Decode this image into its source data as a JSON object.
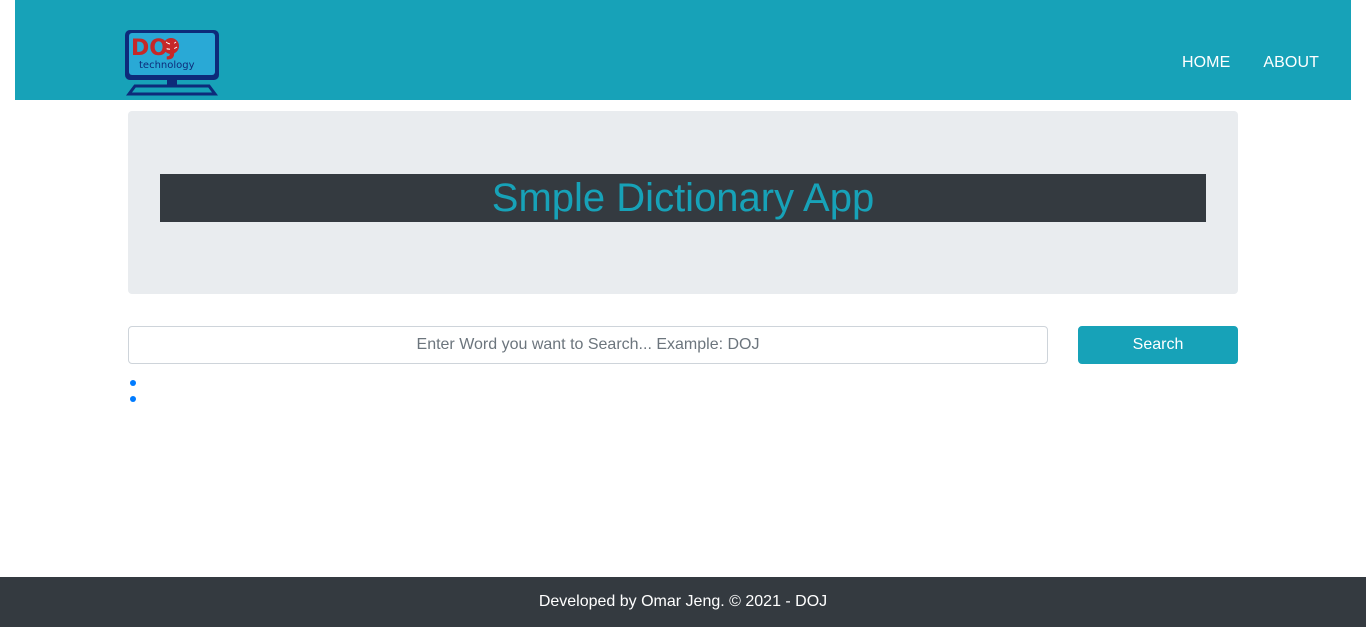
{
  "brand": {
    "logo_text": "DOJ",
    "logo_subtext": "technology"
  },
  "nav": {
    "items": [
      {
        "label": "HOME"
      },
      {
        "label": "ABOUT"
      }
    ]
  },
  "hero": {
    "title": "Smple Dictionary App"
  },
  "search": {
    "placeholder": "Enter Word you want to Search... Example: DOJ",
    "value": "",
    "button_label": "Search"
  },
  "results": {
    "items": [
      "",
      ""
    ]
  },
  "footer": {
    "text": "Developed by Omar Jeng. © 2021 - DOJ"
  },
  "colors": {
    "primary": "#17a2b8",
    "dark": "#343a40",
    "light": "#e9ecef",
    "link_bullet": "#007bff"
  }
}
